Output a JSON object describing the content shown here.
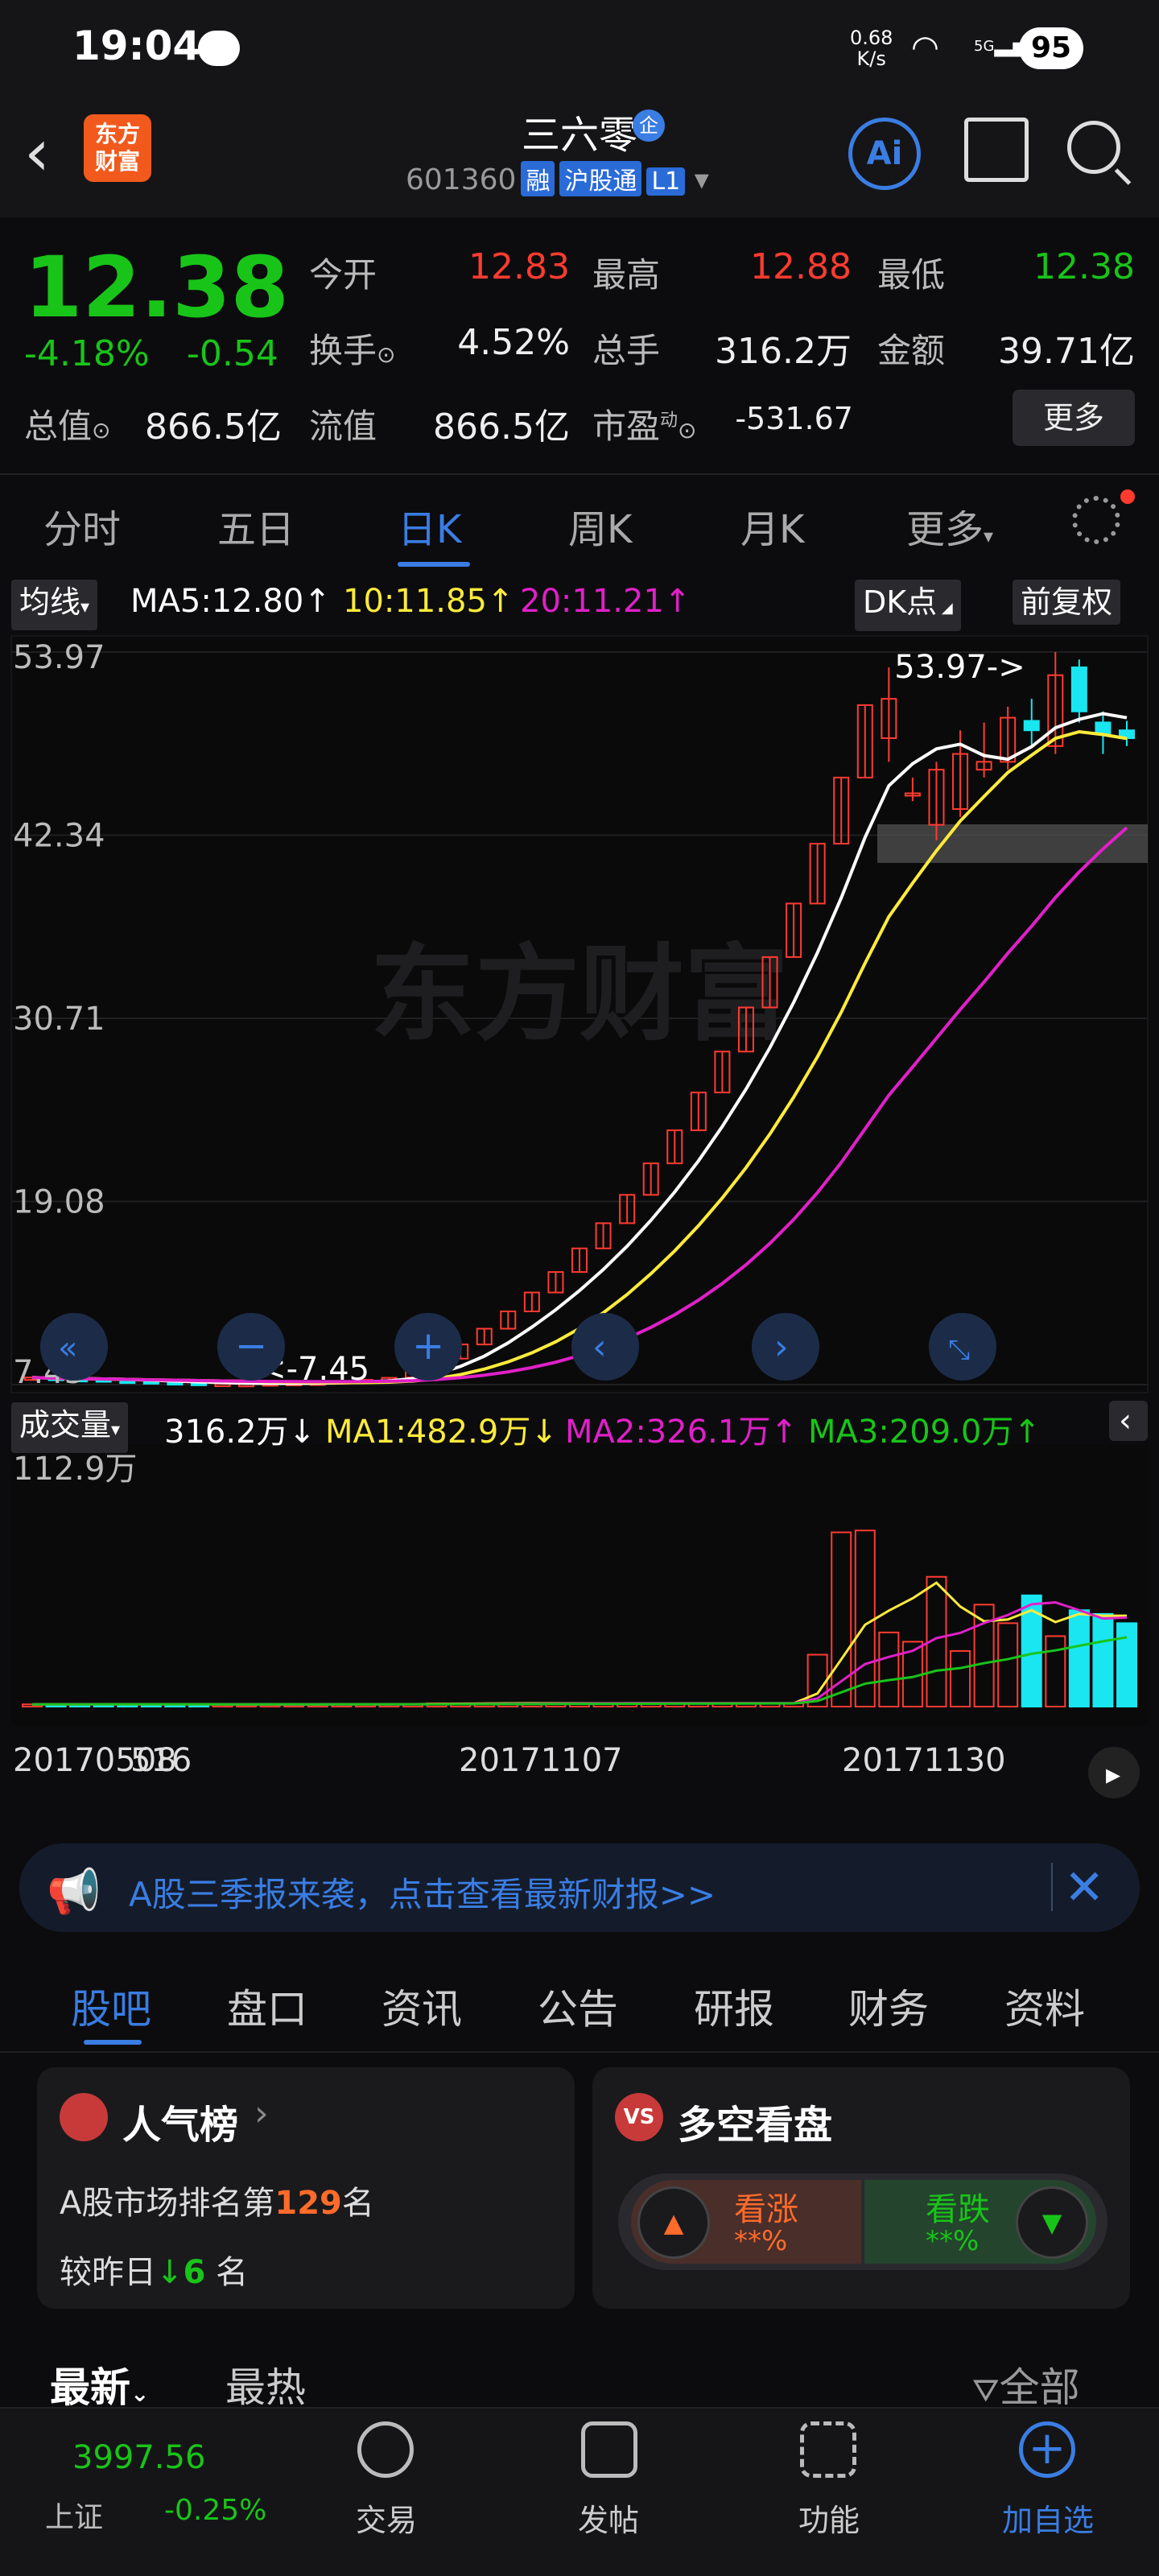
{
  "status_bar": {
    "time": "19:04",
    "net_speed": "0.68",
    "net_unit": "K/s",
    "signal": "5G",
    "battery": "95"
  },
  "header": {
    "back": "‹",
    "logo_line1": "东方",
    "logo_line2": "财富",
    "name": "三六零",
    "badge": "企",
    "code": "601360",
    "tags": [
      "融",
      "沪股通",
      "L1"
    ],
    "ai_label": "Ai"
  },
  "quote": {
    "price": "12.38",
    "change_pct": "-4.18%",
    "change": "-0.54",
    "open_label": "今开",
    "open": "12.83",
    "high_label": "最高",
    "high": "12.88",
    "low_label": "最低",
    "low": "12.38",
    "turnover_label": "换手",
    "turnover": "4.52%",
    "volume_label": "总手",
    "volume": "316.2万",
    "amount_label": "金额",
    "amount": "39.71亿",
    "mcap_label": "总值",
    "mcap": "866.5亿",
    "float_label": "流值",
    "float": "866.5亿",
    "pe_label": "市盈",
    "pe_sup": "动",
    "pe": "-531.67",
    "more": "更多"
  },
  "chart_tabs": [
    "分时",
    "五日",
    "日K",
    "周K",
    "月K",
    "更多"
  ],
  "active_tab": "日K",
  "indicator": {
    "selector": "均线",
    "ma5": "MA5:12.80↑",
    "ma10": "10:11.85↑",
    "ma20": "20:11.21↑",
    "dk": "DK点",
    "adjust": "前复权"
  },
  "volume_indicator": {
    "selector": "成交量",
    "vol": "316.2万↓",
    "ma1": "MA1:482.9万↓",
    "ma2": "MA2:326.1万↑",
    "ma3": "MA3:209.0万↑"
  },
  "banner": {
    "text": "A股三季报来袭，点击查看最新财报>>"
  },
  "sub_tabs": [
    "股吧",
    "盘口",
    "资讯",
    "公告",
    "研报",
    "财务",
    "资料"
  ],
  "active_sub_tab": "股吧",
  "popularity": {
    "title": "人气榜",
    "rank_prefix": "A股市场排名第",
    "rank": "129",
    "rank_suffix": "名",
    "compare_prefix": "较昨日",
    "compare_value": "6",
    "compare_suffix": "名"
  },
  "vs": {
    "title": "多空看盘",
    "bull": "看涨",
    "bear": "看跌",
    "bull_pct": "**%",
    "bear_pct": "**%"
  },
  "feed_tabs": {
    "latest": "最新",
    "hot": "最热",
    "filter": "全部"
  },
  "bottom_nav": {
    "index_value": "3997.56",
    "index_name": "上证",
    "index_change": "-0.25%",
    "items": [
      "交易",
      "发帖",
      "功能",
      "加自选"
    ]
  },
  "colors": {
    "up": "#ff3b30",
    "down": "#19c419",
    "accent": "#3a7de3",
    "ma5": "#ffffff",
    "ma10": "#ffeb3b",
    "ma20": "#e020c8",
    "vol_down": "#19e6f0"
  },
  "chart_data": {
    "type": "candlestick",
    "price_axis_ticks": [
      "53.97",
      "42.34",
      "30.71",
      "19.08",
      "7.45"
    ],
    "ylim": [
      7.45,
      53.97
    ],
    "x_ticks": [
      "20170508",
      "516",
      "20171107",
      "20171130"
    ],
    "max_label": "53.97->",
    "min_label": "<-7.45",
    "watermark": "东方财富",
    "candles": [
      [
        7.9,
        7.95,
        7.85,
        7.9
      ],
      [
        7.88,
        7.9,
        7.8,
        7.82
      ],
      [
        7.8,
        7.85,
        7.75,
        7.78
      ],
      [
        7.78,
        7.8,
        7.7,
        7.72
      ],
      [
        7.7,
        7.75,
        7.65,
        7.68
      ],
      [
        7.66,
        7.7,
        7.6,
        7.62
      ],
      [
        7.6,
        7.65,
        7.55,
        7.58
      ],
      [
        7.56,
        7.6,
        7.5,
        7.52
      ],
      [
        7.5,
        7.55,
        7.47,
        7.5
      ],
      [
        7.48,
        7.52,
        7.45,
        7.49
      ],
      [
        7.49,
        7.55,
        7.47,
        7.53
      ],
      [
        7.53,
        7.58,
        7.5,
        7.55
      ],
      [
        7.56,
        7.6,
        7.52,
        7.58
      ],
      [
        7.6,
        7.7,
        7.58,
        7.66
      ],
      [
        7.68,
        7.8,
        7.65,
        7.75
      ],
      [
        7.78,
        7.9,
        7.75,
        7.88
      ],
      [
        7.9,
        8.3,
        7.9,
        8.3
      ],
      [
        8.3,
        9.1,
        8.3,
        9.1
      ],
      [
        9.1,
        10.0,
        9.1,
        10.0
      ],
      [
        10.0,
        11.0,
        10.0,
        11.0
      ],
      [
        11.0,
        12.1,
        11.0,
        12.1
      ],
      [
        12.1,
        13.3,
        12.1,
        13.3
      ],
      [
        13.3,
        14.6,
        13.3,
        14.6
      ],
      [
        14.6,
        16.1,
        14.6,
        16.1
      ],
      [
        16.1,
        17.7,
        16.1,
        17.7
      ],
      [
        17.7,
        19.5,
        17.7,
        19.5
      ],
      [
        19.5,
        21.5,
        19.5,
        21.5
      ],
      [
        21.5,
        23.6,
        21.5,
        23.6
      ],
      [
        23.6,
        26.0,
        23.6,
        26.0
      ],
      [
        26.0,
        28.6,
        26.0,
        28.6
      ],
      [
        28.6,
        31.4,
        28.6,
        31.4
      ],
      [
        31.4,
        34.6,
        31.4,
        34.6
      ],
      [
        34.6,
        38.0,
        34.6,
        38.0
      ],
      [
        38.0,
        41.8,
        38.0,
        41.8
      ],
      [
        41.8,
        46.0,
        41.8,
        46.0
      ],
      [
        46.0,
        50.6,
        46.0,
        50.6
      ],
      [
        48.5,
        53.0,
        47.0,
        51.0
      ],
      [
        45.0,
        46.0,
        44.5,
        45.0
      ],
      [
        43.0,
        47.0,
        42.0,
        46.5
      ],
      [
        44.0,
        49.0,
        43.5,
        47.5
      ],
      [
        46.5,
        49.5,
        46.0,
        47.0
      ],
      [
        47.0,
        50.5,
        46.5,
        49.8
      ],
      [
        49.6,
        51.0,
        48.0,
        49.0
      ],
      [
        48.0,
        53.97,
        47.5,
        52.5
      ],
      [
        53.0,
        53.5,
        49.5,
        50.2
      ],
      [
        49.5,
        50.2,
        47.5,
        48.8
      ],
      [
        49.0,
        49.6,
        48.0,
        48.5
      ]
    ],
    "volume_ylim": [
      0,
      112.9
    ],
    "volume_max_label": "112.9万"
  }
}
